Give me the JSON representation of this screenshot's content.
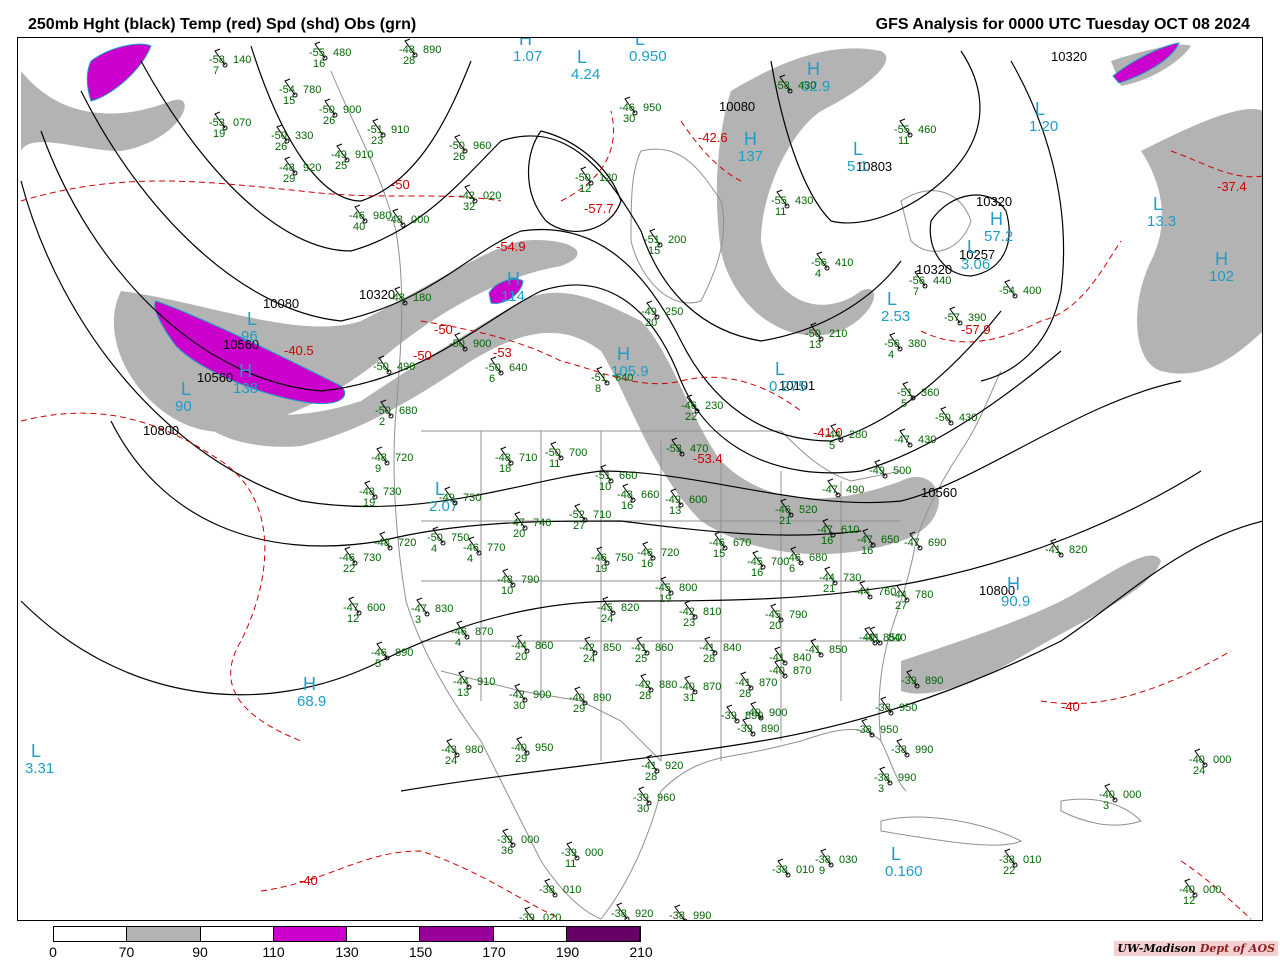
{
  "title_left": "250mb Hght (black) Temp (red) Spd (shd) Obs (grn)",
  "title_right": "GFS Analysis for 0000 UTC Tuesday  OCT 08 2024",
  "credit": {
    "org": "UW-Madison",
    "dept": "Dept of AOS"
  },
  "colorbar": {
    "ticks": [
      "0",
      "70",
      "90",
      "110",
      "130",
      "150",
      "170",
      "190",
      "210"
    ],
    "colors": [
      "#ffffff",
      "#b3b3b3",
      "#ffffff",
      "#cc00cc",
      "#ffffff",
      "#990099",
      "#ffffff",
      "#660066"
    ]
  },
  "colors": {
    "height_contour": "#000000",
    "temperature": "#cc0000",
    "speed_70_90": "#b3b3b3",
    "speed_110_130": "#cc00cc",
    "observations": "#006600",
    "hl_markers": "#1e9ec4",
    "geography": "#909090"
  },
  "height_labels": [
    "10320",
    "10080",
    "10803",
    "10320",
    "10257",
    "10320",
    "10080",
    "10320",
    "10560",
    "10101",
    "10560",
    "10800",
    "10800",
    "10560"
  ],
  "temperature_labels": [
    "-50",
    "-57.7",
    "-54.9",
    "-50",
    "-53",
    "-42.6",
    "-40.5",
    "-50",
    "-41.0",
    "-53.4",
    "-57.9",
    "-37.4",
    "-40",
    "-40"
  ],
  "hl_markers": [
    {
      "t": "H",
      "v": "1.07"
    },
    {
      "t": "L",
      "v": "4.24"
    },
    {
      "t": "L",
      "v": "0.950"
    },
    {
      "t": "H",
      "v": "62.9"
    },
    {
      "t": "L",
      "v": "1.20"
    },
    {
      "t": "H",
      "v": "137"
    },
    {
      "t": "L",
      "v": "13.3"
    },
    {
      "t": "H",
      "v": "102"
    },
    {
      "t": "L",
      "v": "2.53"
    },
    {
      "t": "H",
      "v": "57.2"
    },
    {
      "t": "L",
      "v": "3.06"
    },
    {
      "t": "H",
      "v": "114"
    },
    {
      "t": "L",
      "v": "96"
    },
    {
      "t": "H",
      "v": "138"
    },
    {
      "t": "L",
      "v": "90"
    },
    {
      "t": "H",
      "v": "105.9"
    },
    {
      "t": "L",
      "v": "0.275"
    },
    {
      "t": "L",
      "v": "2.07"
    },
    {
      "t": "H",
      "v": "68.9"
    },
    {
      "t": "L",
      "v": "3.31"
    },
    {
      "t": "H",
      "v": "90.9"
    },
    {
      "t": "L",
      "v": "0.160"
    },
    {
      "t": "L",
      "v": "5.1"
    }
  ],
  "observations": [
    {
      "t": "-58",
      "p": "140",
      "s": "7"
    },
    {
      "t": "-55",
      "p": "480",
      "s": "16"
    },
    {
      "t": "-48",
      "p": "890",
      "s": "28"
    },
    {
      "t": "-54",
      "p": "780",
      "s": "15"
    },
    {
      "t": "-53",
      "p": "070",
      "s": "19"
    },
    {
      "t": "-50",
      "p": "900",
      "s": "26"
    },
    {
      "t": "-50",
      "p": "330",
      "s": "26"
    },
    {
      "t": "-51",
      "p": "910",
      "s": "23"
    },
    {
      "t": "-48",
      "p": "920",
      "s": "29"
    },
    {
      "t": "-49",
      "p": "910",
      "s": "25"
    },
    {
      "t": "-50",
      "p": "960",
      "s": "26"
    },
    {
      "t": "-42",
      "p": "020",
      "s": "32"
    },
    {
      "t": "-46",
      "p": "980",
      "s": "40"
    },
    {
      "t": "-48",
      "p": "000",
      "s": ""
    },
    {
      "t": "-50",
      "p": "120",
      "s": "12"
    },
    {
      "t": "-46",
      "p": "950",
      "s": "30"
    },
    {
      "t": "-51",
      "p": "200",
      "s": "15"
    },
    {
      "t": "-58",
      "p": "430",
      "s": ""
    },
    {
      "t": "-55",
      "p": "460",
      "s": "11"
    },
    {
      "t": "-55",
      "p": "430",
      "s": "11"
    },
    {
      "t": "-56",
      "p": "410",
      "s": "4"
    },
    {
      "t": "-56",
      "p": "440",
      "s": "7"
    },
    {
      "t": "-54",
      "p": "400",
      "s": ""
    },
    {
      "t": "-57",
      "p": "390",
      "s": ""
    },
    {
      "t": "-56",
      "p": "380",
      "s": "4"
    },
    {
      "t": "-51",
      "p": "360",
      "s": "5"
    },
    {
      "t": "-50",
      "p": "430",
      "s": ""
    },
    {
      "t": "-47",
      "p": "430",
      "s": ""
    },
    {
      "t": "-49",
      "p": "250",
      "s": "20"
    },
    {
      "t": "-50",
      "p": "210",
      "s": "13"
    },
    {
      "t": "-44",
      "p": "280",
      "s": "5"
    },
    {
      "t": "-48",
      "p": "180",
      "s": ""
    },
    {
      "t": "-50",
      "p": "900",
      "s": ""
    },
    {
      "t": "-50",
      "p": "640",
      "s": "6"
    },
    {
      "t": "-51",
      "p": "640",
      "s": "8"
    },
    {
      "t": "-46",
      "p": "230",
      "s": "22"
    },
    {
      "t": "-50",
      "p": "490",
      "s": ""
    },
    {
      "t": "-50",
      "p": "680",
      "s": "2"
    },
    {
      "t": "-53",
      "p": "470",
      "s": ""
    },
    {
      "t": "-48",
      "p": "720",
      "s": "9"
    },
    {
      "t": "-48",
      "p": "710",
      "s": "18"
    },
    {
      "t": "-50",
      "p": "700",
      "s": "11"
    },
    {
      "t": "-51",
      "p": "660",
      "s": "10"
    },
    {
      "t": "-48",
      "p": "660",
      "s": "16"
    },
    {
      "t": "-49",
      "p": "600",
      "s": "13"
    },
    {
      "t": "-48",
      "p": "730",
      "s": "19"
    },
    {
      "t": "-49",
      "p": "730",
      "s": ""
    },
    {
      "t": "-50",
      "p": "750",
      "s": "4"
    },
    {
      "t": "-47",
      "p": "740",
      "s": "20"
    },
    {
      "t": "-52",
      "p": "710",
      "s": "27"
    },
    {
      "t": "-48",
      "p": "720",
      "s": ""
    },
    {
      "t": "-46",
      "p": "730",
      "s": "22"
    },
    {
      "t": "-46",
      "p": "770",
      "s": "4"
    },
    {
      "t": "-46",
      "p": "750",
      "s": "19"
    },
    {
      "t": "-46",
      "p": "720",
      "s": "16"
    },
    {
      "t": "-46",
      "p": "670",
      "s": "15"
    },
    {
      "t": "-45",
      "p": "700",
      "s": "16"
    },
    {
      "t": "-46",
      "p": "680",
      "s": "6"
    },
    {
      "t": "-46",
      "p": "520",
      "s": "21"
    },
    {
      "t": "-47",
      "p": "610",
      "s": "16"
    },
    {
      "t": "-47",
      "p": "490",
      "s": ""
    },
    {
      "t": "-49",
      "p": "500",
      "s": ""
    },
    {
      "t": "-47",
      "p": "650",
      "s": "16"
    },
    {
      "t": "-47",
      "p": "690",
      "s": ""
    },
    {
      "t": "-47",
      "p": "600",
      "s": "12"
    },
    {
      "t": "-47",
      "p": "830",
      "s": "3"
    },
    {
      "t": "-48",
      "p": "790",
      "s": "10"
    },
    {
      "t": "-45",
      "p": "800",
      "s": "19"
    },
    {
      "t": "-45",
      "p": "820",
      "s": "24"
    },
    {
      "t": "-42",
      "p": "810",
      "s": "23"
    },
    {
      "t": "-45",
      "p": "790",
      "s": "20"
    },
    {
      "t": "-44",
      "p": "730",
      "s": "21"
    },
    {
      "t": "-44",
      "p": "760",
      "s": ""
    },
    {
      "t": "-44",
      "p": "780",
      "s": "27"
    },
    {
      "t": "-46",
      "p": "870",
      "s": "4"
    },
    {
      "t": "-44",
      "p": "860",
      "s": "20"
    },
    {
      "t": "-42",
      "p": "850",
      "s": "24"
    },
    {
      "t": "-41",
      "p": "860",
      "s": "25"
    },
    {
      "t": "-41",
      "p": "840",
      "s": "28"
    },
    {
      "t": "-41",
      "p": "840",
      "s": ""
    },
    {
      "t": "-41",
      "p": "850",
      "s": ""
    },
    {
      "t": "-40",
      "p": "850",
      "s": ""
    },
    {
      "t": "-46",
      "p": "890",
      "s": "5"
    },
    {
      "t": "-44",
      "p": "910",
      "s": "13"
    },
    {
      "t": "-42",
      "p": "900",
      "s": "30"
    },
    {
      "t": "-40",
      "p": "890",
      "s": "29"
    },
    {
      "t": "-42",
      "p": "880",
      "s": "28"
    },
    {
      "t": "-40",
      "p": "870",
      "s": "31"
    },
    {
      "t": "-41",
      "p": "870",
      "s": "28"
    },
    {
      "t": "-40",
      "p": "870",
      "s": ""
    },
    {
      "t": "-39",
      "p": "890",
      "s": ""
    },
    {
      "t": "-40",
      "p": "900",
      "s": ""
    },
    {
      "t": "-39",
      "p": "890",
      "s": ""
    },
    {
      "t": "-38",
      "p": "950",
      "s": ""
    },
    {
      "t": "-38",
      "p": "950",
      "s": ""
    },
    {
      "t": "-38",
      "p": "990",
      "s": ""
    },
    {
      "t": "-38",
      "p": "990",
      "s": "3"
    },
    {
      "t": "-43",
      "p": "980",
      "s": "24"
    },
    {
      "t": "-40",
      "p": "950",
      "s": "29"
    },
    {
      "t": "-41",
      "p": "920",
      "s": "28"
    },
    {
      "t": "-39",
      "p": "960",
      "s": "30"
    },
    {
      "t": "-39",
      "p": "000",
      "s": "36"
    },
    {
      "t": "-39",
      "p": "000",
      "s": "11"
    },
    {
      "t": "-38",
      "p": "010",
      "s": ""
    },
    {
      "t": "-39",
      "p": "020",
      "s": ""
    },
    {
      "t": "-38",
      "p": "920",
      "s": ""
    },
    {
      "t": "-38",
      "p": "990",
      "s": ""
    },
    {
      "t": "-38",
      "p": "030",
      "s": "9"
    },
    {
      "t": "-38",
      "p": "010",
      "s": ""
    },
    {
      "t": "-38",
      "p": "010",
      "s": "22"
    },
    {
      "t": "-40",
      "p": "000",
      "s": "24"
    },
    {
      "t": "-40",
      "p": "000",
      "s": "3"
    },
    {
      "t": "-40",
      "p": "000",
      "s": "12"
    },
    {
      "t": "-41",
      "p": "820",
      "s": ""
    },
    {
      "t": "-41",
      "p": "840",
      "s": ""
    },
    {
      "t": "-39",
      "p": "890",
      "s": ""
    }
  ]
}
